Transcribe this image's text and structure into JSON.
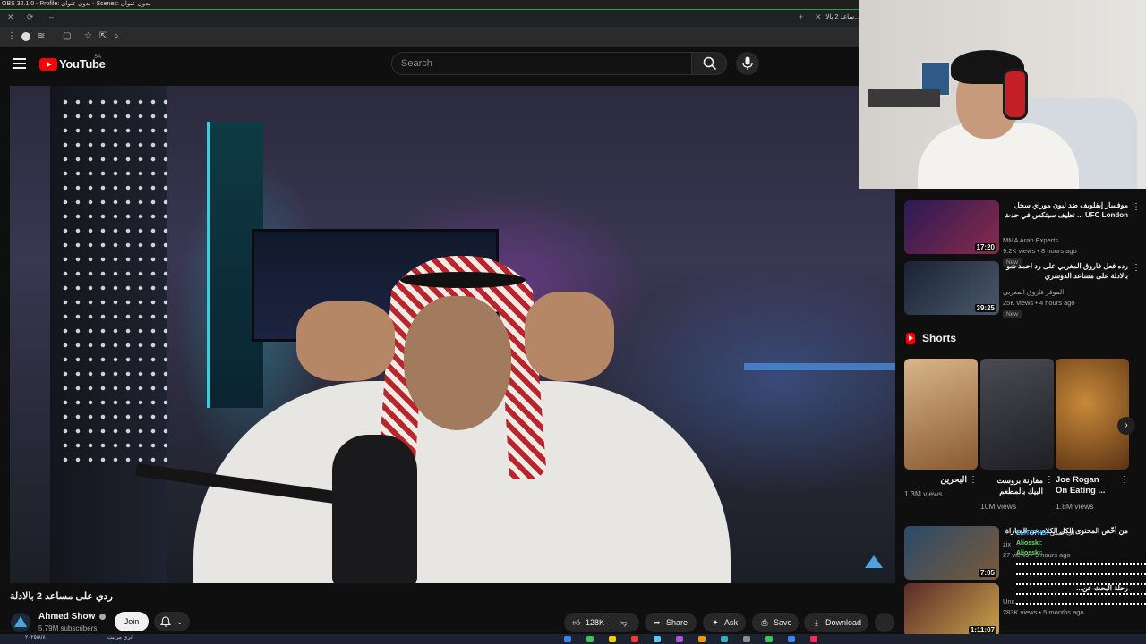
{
  "obs": {
    "title": "OBS 32.1.0 - Profile: بدون عنوان - Scenes: بدون عنوان"
  },
  "browser": {
    "tab_title": "ساعد 2 بالا..."
  },
  "youtube": {
    "logo_text": "YouTube",
    "country": "SA",
    "search_placeholder": "Search"
  },
  "video": {
    "title": "ردي على مساعد 2 بالادلة",
    "channel": "Ahmed Show",
    "subscribers": "5.79M subscribers",
    "join_label": "Join",
    "likes": "128K",
    "share_label": "Share",
    "ask_label": "Ask",
    "save_label": "Save",
    "download_label": "Download"
  },
  "sidebar": {
    "recommendations": [
      {
        "title": "موفسار إيفلويف ضد ليون موراي سجل UFC London ... نظيف سيتكس في حدث",
        "channel": "MMA Arab Experts",
        "meta": "9.2K views • 8 hours ago",
        "badge": "New",
        "duration": "17:20",
        "thumb_color": "#3a2a6a"
      },
      {
        "title": "رده فعل فاروق المغربي على رد احمد شو بالادلة على مساعد الدوسري",
        "channel": "الموقر فاروق المغربي",
        "meta": "25K views • 4 hours ago",
        "badge": "New",
        "duration": "39:25",
        "thumb_color": "#2a3344"
      }
    ],
    "shorts_title": "Shorts",
    "shorts": [
      {
        "title": "البحرين",
        "views": "1.3M views",
        "color": "#b98b5a"
      },
      {
        "title": "مقارنة بروست البيك بالمطعم",
        "views": "10M views",
        "color": "#3b3b44"
      },
      {
        "title": "Joe Rogan On Eating ...",
        "views": "1.8M views",
        "color": "#8a5a2a"
      }
    ],
    "more_recommendations": [
      {
        "title": "من أخّص المحتوى الكل الكلام عن المباراة",
        "channel": "zix",
        "meta": "27 views • 9 hours ago",
        "duration": "7:05",
        "thumb_color": "#3a5a7a"
      },
      {
        "title": "رحلة البحث عن...",
        "channel": "Unc...",
        "meta": "283K views • 5 months ago",
        "duration": "1:11:07",
        "thumb_color": "#6a3a2a"
      }
    ]
  },
  "chat": [
    {
      "name": "ELITE7HS:",
      "msg": "اف عسى",
      "color": "#3fb6ff"
    },
    {
      "name": "Aliosski:",
      "msg": "",
      "color": "#5ee05e"
    },
    {
      "name": "Aliosski:",
      "msg": "",
      "color": "#5ee05e"
    }
  ],
  "taskbar": {
    "date": "٢٠٢٥/٨/٨",
    "text": "اترى مرتبت"
  },
  "colors": {
    "accent": "#ff0000",
    "background": "#0f0f0f",
    "pill": "#272727",
    "obs_green": "#2ea043"
  },
  "icons": [
    "menu-icon",
    "search-icon",
    "mic-icon",
    "bell-icon",
    "like-icon",
    "dislike-icon",
    "share-icon",
    "ask-icon",
    "save-icon",
    "download-icon",
    "more-icon",
    "verified-icon"
  ]
}
